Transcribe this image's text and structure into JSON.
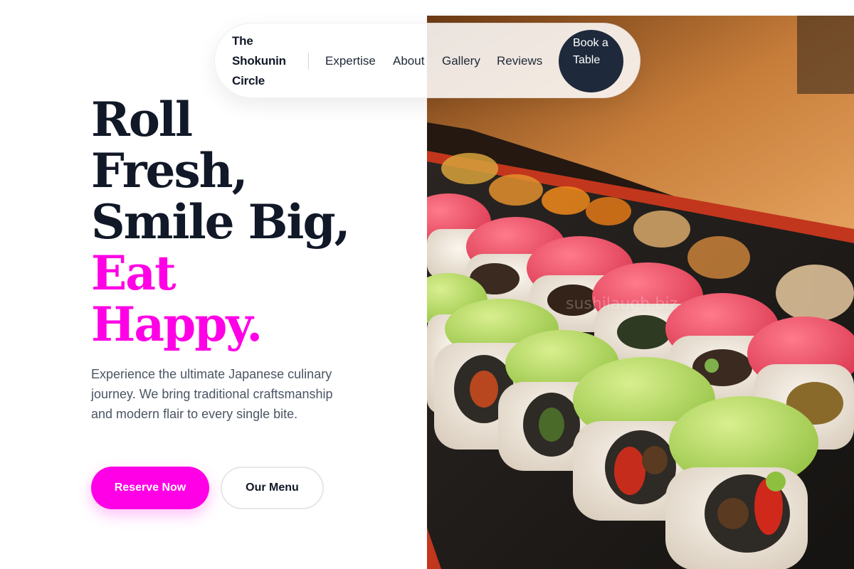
{
  "nav": {
    "brand": "The Shokunin Circle",
    "links": [
      "Expertise",
      "About",
      "Gallery",
      "Reviews"
    ],
    "cta": "Book a Table"
  },
  "hero": {
    "headline_lines": [
      "Roll",
      "Fresh,",
      "Smile Big,"
    ],
    "headline_accent_lines": [
      "Eat",
      "Happy."
    ],
    "subtext": "Experience the ultimate Japanese culinary journey. We bring traditional craftsmanship and modern flair to every single bite.",
    "primary_button": "Reserve Now",
    "secondary_button": "Our Menu"
  },
  "photo": {
    "alt_content": "sushi rolls platter",
    "watermark": "sushilaugh.biz"
  },
  "colors": {
    "accent": "#ff00e6",
    "dark": "#1e293b",
    "text": "#111827",
    "muted": "#4b5563"
  }
}
